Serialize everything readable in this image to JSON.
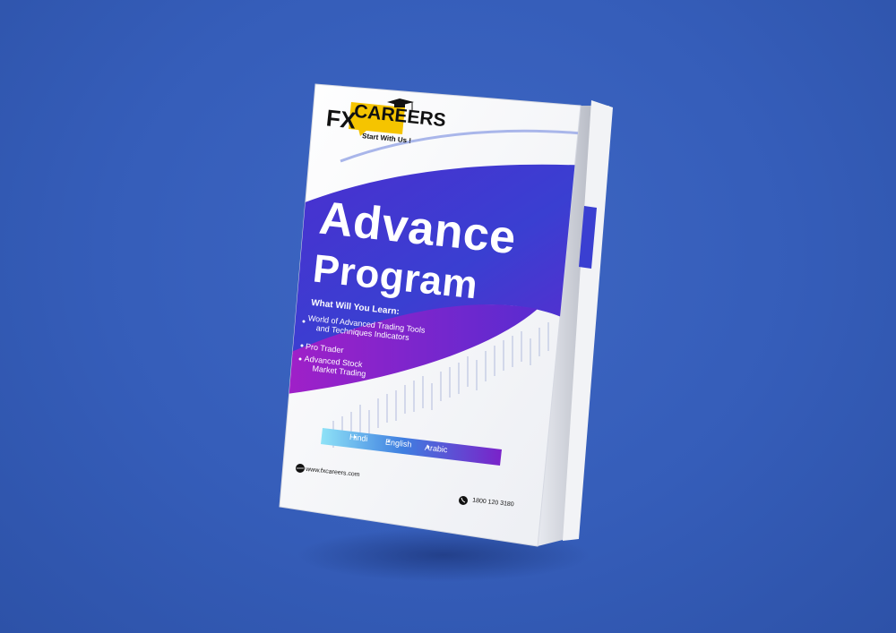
{
  "background_color": "#355db9",
  "book": {
    "logo": {
      "fx": "FX",
      "careers": "CAREERS",
      "tagline": "Start With Us !",
      "icon": "graduation-cap-icon",
      "badge_color": "#f5c400"
    },
    "title_line1": "Advance",
    "title_line2": "Program",
    "learn_heading": "What Will You Learn:",
    "topics": [
      {
        "line1": "World of Advanced Trading Tools",
        "line2": "and Techniques Indicators"
      },
      {
        "line1": "Pro Trader",
        "line2": ""
      },
      {
        "line1": "Advanced Stock",
        "line2": "Market Trading"
      }
    ],
    "languages": [
      "Hindi",
      "English",
      "Arabic"
    ],
    "website": "www.fxcareers.com",
    "website_icon": "globe-icon",
    "phone": "1800 120 3180",
    "phone_icon": "phone-icon",
    "accent_colors": {
      "blue": "#3a3fd1",
      "purple": "#7a1fc9",
      "cyan": "#6fd3f5"
    }
  }
}
